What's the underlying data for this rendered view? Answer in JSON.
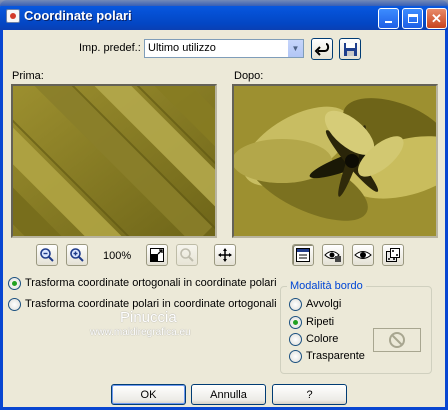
{
  "window": {
    "title": "Coordinate polari"
  },
  "preset": {
    "label": "Imp. predef.:",
    "value": "Ultimo utilizzo"
  },
  "previews": {
    "before_label": "Prima:",
    "after_label": "Dopo:"
  },
  "zoom": {
    "level": "100%"
  },
  "options": {
    "rect_to_polar": "Trasforma coordinate ortogonali in coordinate polari",
    "polar_to_rect": "Trasforma coordinate polari in coordinate ortogonali",
    "selected": "rect_to_polar"
  },
  "edge_mode": {
    "title": "Modalità bordo",
    "items": [
      "Avvolgi",
      "Ripeti",
      "Colore",
      "Trasparente"
    ],
    "selected": "Ripeti"
  },
  "watermark": {
    "name": "Pinuccia",
    "site": "www.maidiregrafica.eu"
  },
  "buttons": {
    "ok": "OK",
    "cancel": "Annulla",
    "help": "?"
  },
  "colors": {
    "title_bar": "#0a5fe8",
    "dialog_bg": "#ece9d8",
    "legend_text": "#0046d5",
    "radio_dot": "#21a121"
  }
}
